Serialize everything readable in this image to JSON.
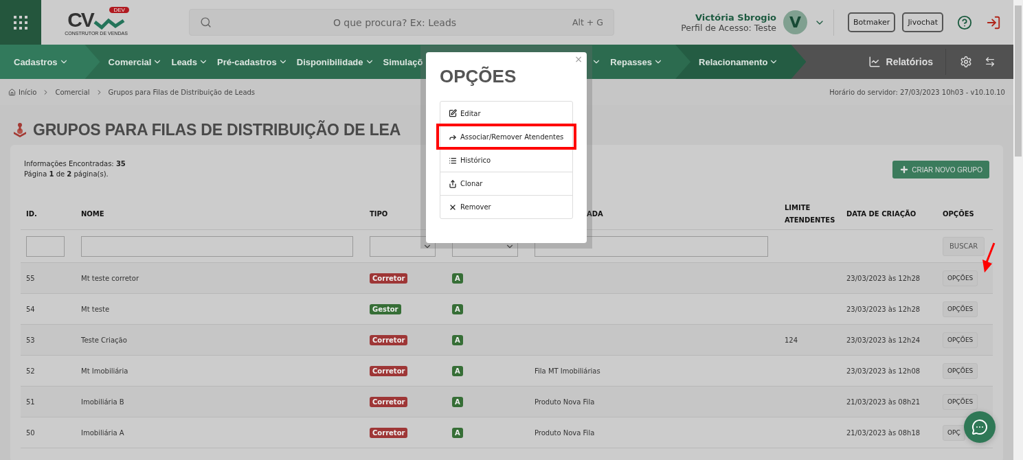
{
  "header": {
    "logo": {
      "mark": "CV",
      "badge": "DEV",
      "tagline": "CONSTRUTOR DE VENDAS"
    },
    "search": {
      "placeholder": "O que procura? Ex: Leads",
      "shortcut": "Alt + G"
    },
    "user": {
      "name": "Victória Sbrogio",
      "profile": "Perfil de Acesso: Teste",
      "initial": "V"
    },
    "buttons": [
      "Botmaker",
      "Jivochat"
    ]
  },
  "nav": {
    "groups": [
      {
        "kind": "first",
        "items": [
          "Cadastros"
        ]
      },
      {
        "kind": "middle",
        "items": [
          "Comercial",
          "Leads",
          "Pré-cadastros",
          "Disponibilidade",
          "Simulaçõ"
        ],
        "after": [
          "Repasses"
        ]
      },
      {
        "kind": "last",
        "items": [
          "Relacionamento"
        ]
      }
    ],
    "reports": "Relatórios"
  },
  "breadcrumb": {
    "items": [
      "Início",
      "Comercial",
      "Grupos para Filas de Distribuição de Leads"
    ],
    "server_time": "Horário do servidor: 27/03/2023 10h03 - v10.10.10"
  },
  "page_title": "GRUPOS PARA FILAS DE DISTRIBUIÇÃO DE LEA",
  "summary": {
    "found": "Informações Encontradas: **35**",
    "page": "Página **1** de **2** página(s)."
  },
  "create_button": "CRIAR NOVO GRUPO",
  "table": {
    "columns": [
      {
        "label": "ID.",
        "kind": "input"
      },
      {
        "label": "NOME",
        "kind": "input"
      },
      {
        "label": "TIPO",
        "kind": "select"
      },
      {
        "kind": "select"
      },
      {
        "label": "ADA",
        "kind": "input"
      },
      {
        "label": "LIMITE ATENDENTES",
        "kind": "none"
      },
      {
        "label": "DATA DE CRIAÇÃO",
        "kind": "none"
      },
      {
        "label": "OPÇÕES",
        "kind": "button"
      }
    ],
    "search_button": "BUSCAR",
    "rows": [
      {
        "id": "55",
        "name": "Mt teste corretor",
        "type": {
          "label": "Corretor",
          "color": "#9e3636"
        },
        "status": "A",
        "column_5": "",
        "limit": "",
        "created": "23/03/2023 às 12h28",
        "options": "OPÇÕES"
      },
      {
        "id": "54",
        "name": "Mt teste",
        "type": {
          "label": "Gestor",
          "color": "#366e36"
        },
        "status": "A",
        "column_5": "",
        "limit": "",
        "created": "23/03/2023 às 12h28",
        "options": "OPÇÕES"
      },
      {
        "id": "53",
        "name": "Teste Criação",
        "type": {
          "label": "Corretor",
          "color": "#9e3636"
        },
        "status": "A",
        "column_5": "",
        "limit": "124",
        "created": "23/03/2023 às 12h24",
        "options": "OPÇÕES"
      },
      {
        "id": "52",
        "name": "Mt Imobiliária",
        "type": {
          "label": "Corretor",
          "color": "#9e3636"
        },
        "status": "A",
        "column_5": "Fila MT Imobiliárias",
        "limit": "",
        "created": "23/03/2023 às 12h08",
        "options": "OPÇÕES"
      },
      {
        "id": "51",
        "name": "Imobiliária B",
        "type": {
          "label": "Corretor",
          "color": "#9e3636"
        },
        "status": "A",
        "column_5": "Produto Nova Fila",
        "limit": "",
        "created": "21/03/2023 às 08h21",
        "options": "OPÇÕES"
      },
      {
        "id": "50",
        "name": "Imobiliária A",
        "type": {
          "label": "Corretor",
          "color": "#9e3636"
        },
        "status": "A",
        "column_5": "Produto Nova Fila",
        "limit": "",
        "created": "21/03/2023 às 08h18",
        "options": "OPÇ"
      }
    ]
  },
  "modal": {
    "title": "OPÇÕES",
    "close": "×",
    "options": [
      {
        "kind": "edit",
        "label": "Editar",
        "highlighted": false
      },
      {
        "kind": "forward",
        "label": "Associar/Remover Atendentes",
        "highlighted": true
      },
      {
        "kind": "list",
        "label": "Histórico",
        "highlighted": false
      },
      {
        "kind": "clone",
        "label": "Clonar",
        "highlighted": false
      },
      {
        "kind": "remove",
        "label": "Remover",
        "highlighted": false
      }
    ]
  }
}
